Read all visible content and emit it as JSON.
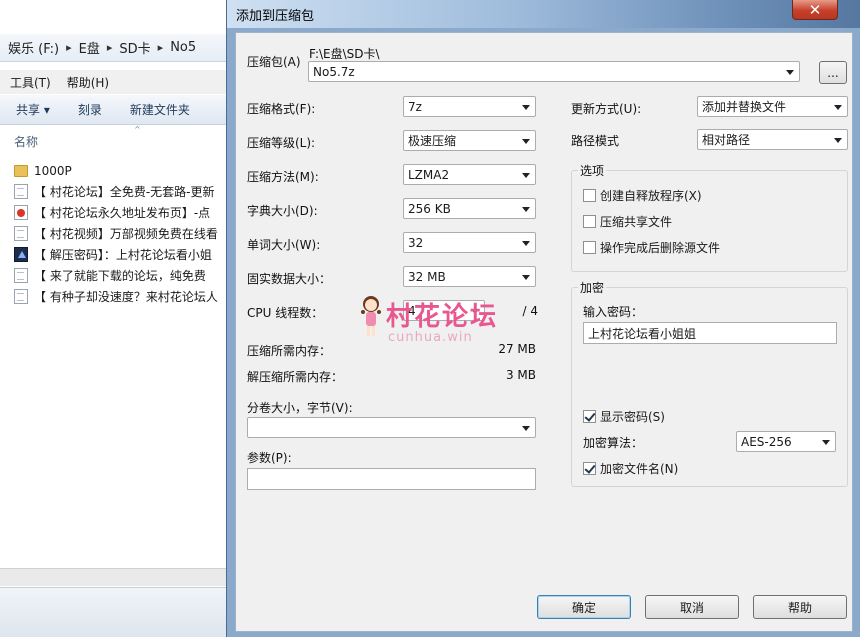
{
  "explorer": {
    "breadcrumb": [
      "娱乐 (F:)",
      "E盘",
      "SD卡",
      "No5"
    ],
    "menu": [
      "工具(T)",
      "帮助(H)"
    ],
    "toolbar": {
      "share": "共享 ▾",
      "burn": "刻录",
      "new_folder": "新建文件夹"
    },
    "column_header": "名称",
    "files": [
      {
        "name": "1000P",
        "icon": "folder-icon"
      },
      {
        "name": "【 村花论坛】全免费-无套路-更新",
        "icon": "document-icon"
      },
      {
        "name": "【 村花论坛永久地址发布页】-点",
        "icon": "shortcut-icon"
      },
      {
        "name": "【 村花视频】万部视频免费在线看",
        "icon": "document-icon"
      },
      {
        "name": "【 解压密码】：上村花论坛看小姐",
        "icon": "app-icon"
      },
      {
        "name": "【 来了就能下载的论坛，纯免费",
        "icon": "document-icon"
      },
      {
        "name": "【 有种子却没速度？来村花论坛人",
        "icon": "document-icon"
      }
    ]
  },
  "dialog": {
    "title": "添加到压缩包",
    "archive_label": "压缩包(A)",
    "archive_path": "F:\\E盘\\SD卡\\",
    "archive_name": "No5.7z",
    "browse_label": "...",
    "format_label": "压缩格式(F):",
    "format_value": "7z",
    "level_label": "压缩等级(L):",
    "level_value": "极速压缩",
    "method_label": "压缩方法(M):",
    "method_value": "LZMA2",
    "dict_label": "字典大小(D):",
    "dict_value": "256 KB",
    "word_label": "单词大小(W):",
    "word_value": "32",
    "solid_label": "固实数据大小：",
    "solid_value": "32 MB",
    "cpu_label": "CPU 线程数：",
    "cpu_value": "4",
    "cpu_max": "/ 4",
    "mem_compress_label": "压缩所需内存：",
    "mem_compress_value": "27 MB",
    "mem_decompress_label": "解压缩所需内存：",
    "mem_decompress_value": "3 MB",
    "split_label": "分卷大小，字节(V):",
    "split_value": "",
    "params_label": "参数(P):",
    "params_value": "",
    "update_label": "更新方式(U):",
    "update_value": "添加并替换文件",
    "path_label": "路径模式",
    "path_value": "相对路径",
    "options_title": "选项",
    "options": [
      {
        "label": "创建自释放程序(X)",
        "checked": false
      },
      {
        "label": "压缩共享文件",
        "checked": false
      },
      {
        "label": "操作完成后删除源文件",
        "checked": false
      }
    ],
    "encrypt_title": "加密",
    "password_label": "输入密码：",
    "password_value": "上村花论坛看小姐姐",
    "show_password_label": "显示密码(S)",
    "encrypt_method_label": "加密算法：",
    "encrypt_method_value": "AES-256",
    "encrypt_names_label": "加密文件名(N)",
    "ok_label": "确定",
    "cancel_label": "取消",
    "help_label": "帮助",
    "close_label": "✕"
  },
  "watermark": {
    "text": "村花论坛",
    "sub": "cunhua.win"
  }
}
